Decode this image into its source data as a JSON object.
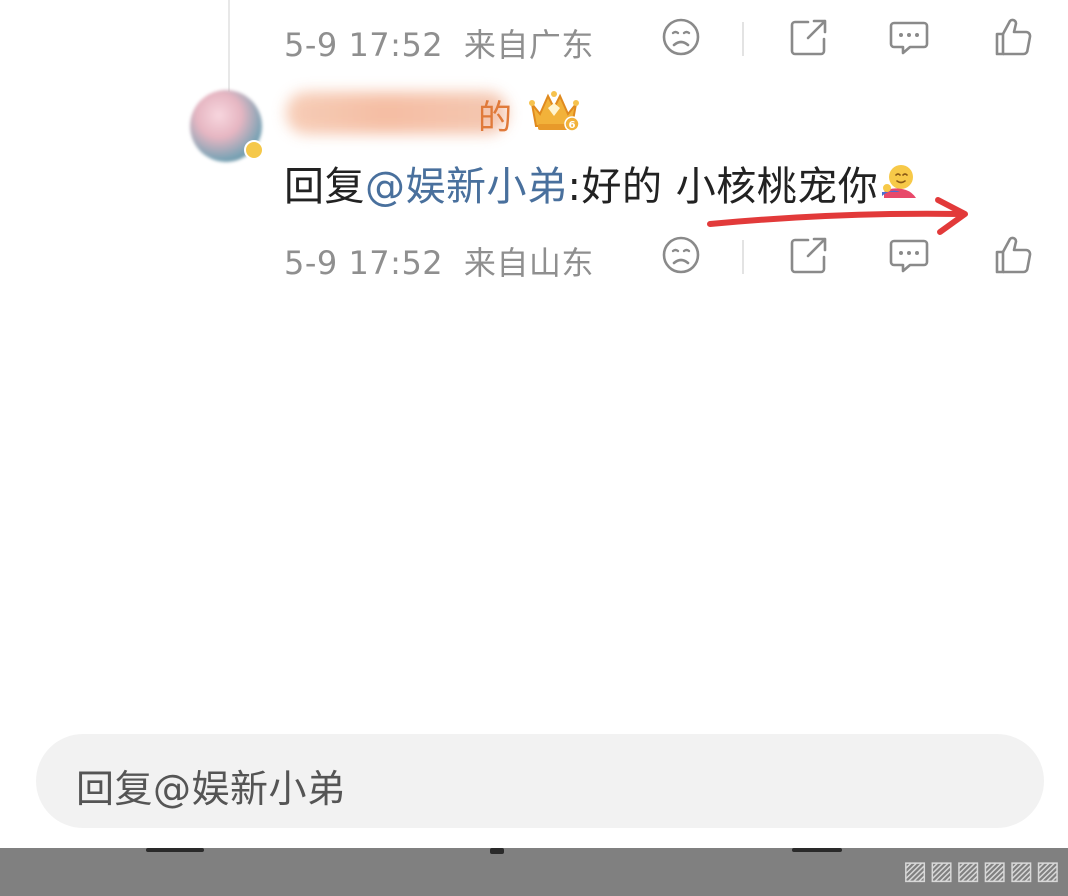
{
  "thread": {
    "previous_comment": {
      "time": "5-9 17:52",
      "location": "来自广东"
    },
    "reply": {
      "username_suffix": "的",
      "badge_level": "6",
      "reply_prefix": "回复",
      "mention": "@娱新小弟",
      "text": ":好的 小核桃宠你",
      "time": "5-9 17:52",
      "location": "来自山东"
    }
  },
  "actions": {
    "icons": [
      "dislike-face-icon",
      "share-icon",
      "comment-icon",
      "like-thumb-icon"
    ]
  },
  "composer": {
    "placeholder": "回复@娱新小弟"
  },
  "colors": {
    "mention": "#49709d",
    "meta": "#8f8f8f",
    "annotation_arrow": "#e23a3a",
    "username": "#e07a3a"
  }
}
